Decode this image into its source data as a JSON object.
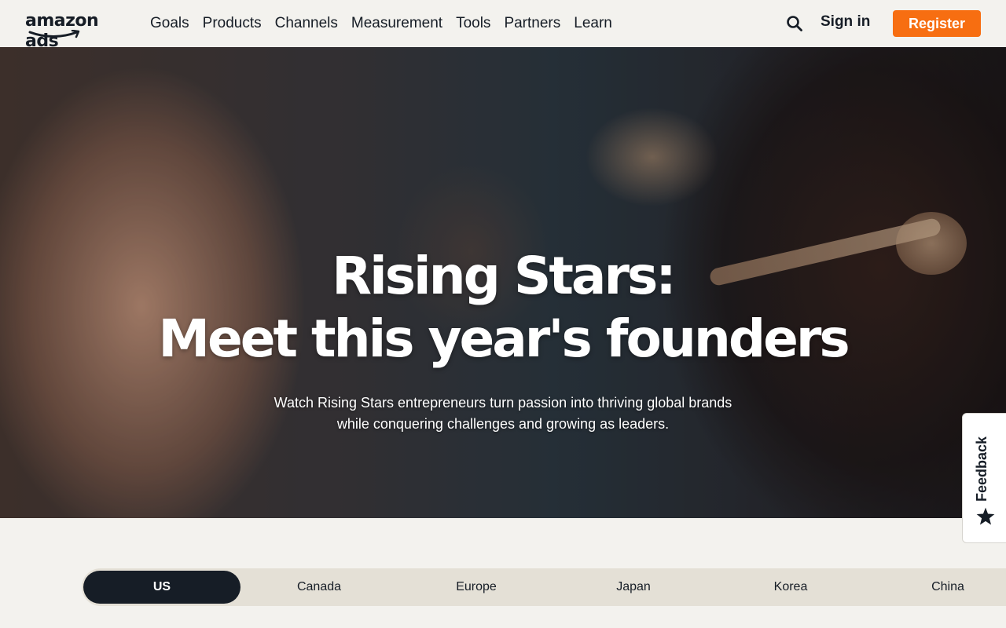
{
  "nav": {
    "logo_text": "amazon ads",
    "menu": [
      "Goals",
      "Products",
      "Channels",
      "Measurement",
      "Tools",
      "Partners",
      "Learn"
    ],
    "signin_label": "Sign in",
    "register_label": "Register",
    "register_color": "#f76e11"
  },
  "hero": {
    "title_line1": "Rising Stars:",
    "title_line2": "Meet this year's founders",
    "subtitle_line1": "Watch Rising Stars entrepreneurs turn passion into thriving global brands",
    "subtitle_line2": "while conquering challenges and growing as leaders."
  },
  "feedback": {
    "label": "Feedback",
    "icon": "star-icon"
  },
  "regions": {
    "active": "US",
    "tabs": [
      "US",
      "Canada",
      "Europe",
      "Japan",
      "Korea",
      "China"
    ]
  }
}
